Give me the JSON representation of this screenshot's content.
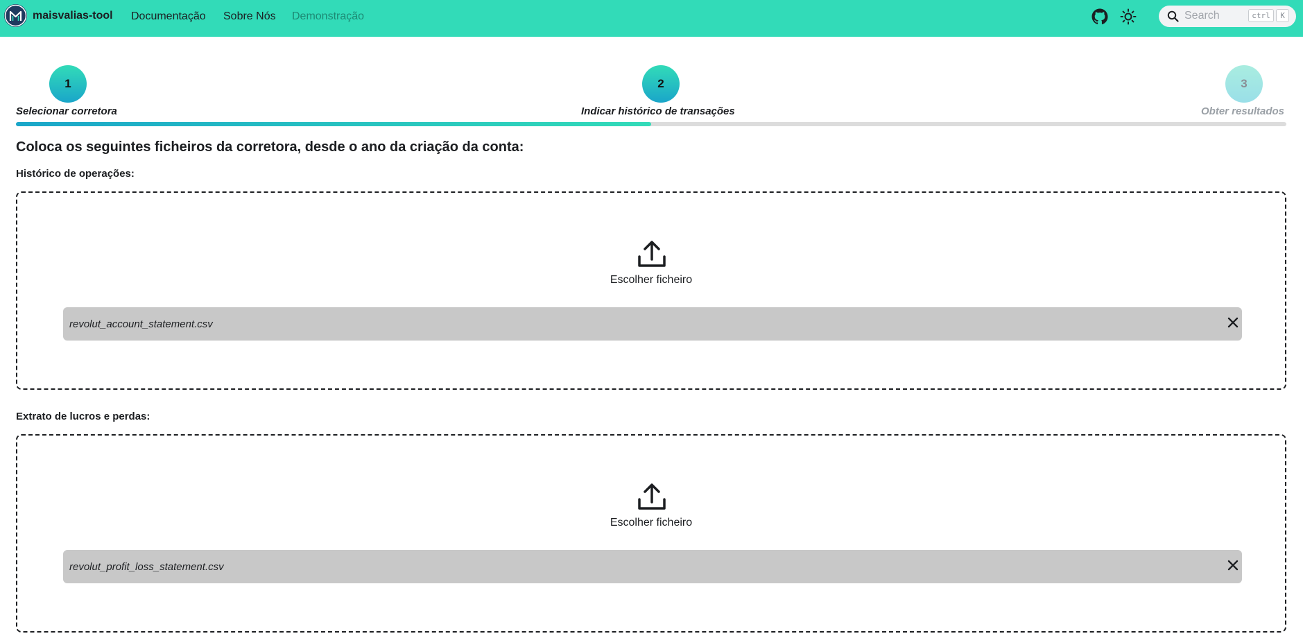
{
  "navbar": {
    "brand": "maisvalias-tool",
    "links": [
      "Documentação",
      "Sobre Nós",
      "Demonstração"
    ],
    "active_link": "Demonstração",
    "search_placeholder": "Search",
    "shortcut_keys": [
      "ctrl",
      "K"
    ],
    "icons": [
      "maisvalias-logo-icon",
      "github-icon",
      "sun-icon",
      "search-icon"
    ],
    "background_color": "#32dbb8"
  },
  "stepper": {
    "steps": [
      {
        "number": "1",
        "label": "Selecionar corretora"
      },
      {
        "number": "2",
        "label": "Indicar histórico de transações"
      },
      {
        "number": "3",
        "label": "Obter resultados"
      }
    ],
    "current_step": 2,
    "progress": 0.5
  },
  "main": {
    "heading": "Coloca os seguintes ficheiros da corretora, desde o ano da criação da conta:",
    "sections": [
      {
        "label": "Histórico de operações:",
        "upload_label": "Escolher ficheiro",
        "file": "revolut_account_statement.csv"
      },
      {
        "label": "Extrato de lucros e perdas:",
        "upload_label": "Escolher ficheiro",
        "file": "revolut_profit_loss_statement.csv"
      }
    ]
  }
}
